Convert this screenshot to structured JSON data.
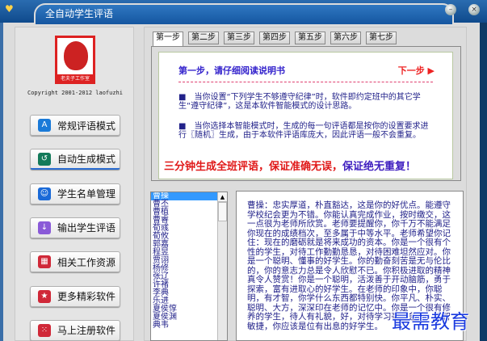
{
  "window": {
    "title": "全自动学生评语",
    "minimize": "–",
    "close": "×"
  },
  "sidebar": {
    "logo_caption": "老夫子工作室",
    "copyright": "Copyright 2001-2012 laofuzhi",
    "buttons": [
      {
        "label": "常规评语模式",
        "icon": "app-store-icon",
        "color": "#1a7ad8"
      },
      {
        "label": "自动生成模式",
        "icon": "history-icon",
        "color": "#137a5a"
      },
      {
        "label": "学生名单管理",
        "icon": "user-icon",
        "color": "#1a6ad8"
      },
      {
        "label": "输出学生评语",
        "icon": "download-icon",
        "color": "#8a5ad8"
      },
      {
        "label": "相关工作资源",
        "icon": "grid-icon",
        "color": "#d02838"
      },
      {
        "label": "更多精彩软件",
        "icon": "star-icon",
        "color": "#d02838"
      },
      {
        "label": "马上注册软件",
        "icon": "dice-icon",
        "color": "#d02838"
      }
    ]
  },
  "tabs": [
    "第一步",
    "第二步",
    "第三步",
    "第四步",
    "第五步",
    "第六步",
    "第七步"
  ],
  "step": {
    "heading": "第一步，请仔细阅读说明书",
    "next": "下一步 ▶",
    "para1": "■　当你设置“下列学生不够遵守纪律”时，软件即约定班中的其它学生“遵守纪律”，这是本软件智能模式的设计思路。",
    "para2": "■　当你选择本智能模式时，生成的每一句评语都是按你的设置要求进行〖随机〗生成，由于本软件评语库庞大，因此评语一般不会重复。",
    "slogan_a": "三分钟生成全班评语，保证准确无误，",
    "slogan_b": "保证绝无重复！"
  },
  "students": [
    "曹操",
    "曹丕",
    "曹植",
    "曹睿",
    "荀彧",
    "荀攸",
    "郭嘉",
    "程昱",
    "贾诩",
    "杨修",
    "张辽",
    "许褚",
    "李典",
    "乐进",
    "夏侯惇",
    "夏侯渊",
    "典韦"
  ],
  "comment": "曹操：忠实厚道，朴直豁达，这是你的好优点。能遵守学校纪会更为不错。你能认真完成作业，按时缴交，这一点很为老师所欣赏。老师要提醒你，你千万不能满足你现在的成绩档次，至多属于中等水平。老师希望你记住：现在的磨砺就是将来成功的资本。你是一个很有个性的学生，对待工作勤勤恳恳，对待困难坦然应对。你是一个聪明、懂事的好学生。你的勤奋刻苦是无与伦比的，你的意志力总是令人欣慰不已。你积极进取的精神真令人赞赏！你是一个聪明，活泼善于开动脑筋，勇于探索，富有进取心的好学生。在老师的印象中，你聪明，有才智，你学什么东西都特别快。你平凡、朴实、聪明、大方，深深印在老师的记忆中。你是一个很有修养的学生，待人有礼貌，好，对待学习毫不怠慢。机智敏捷，你应该是位有出息的好学生。",
  "watermark": "最需教育"
}
